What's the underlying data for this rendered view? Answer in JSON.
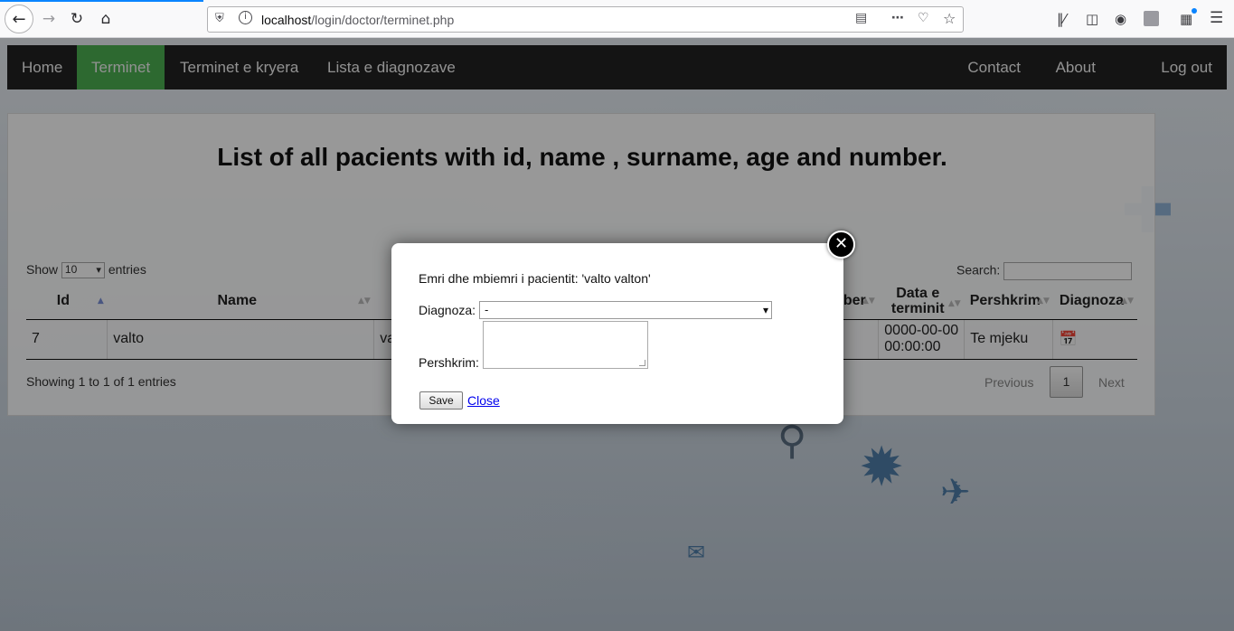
{
  "browser": {
    "url_host": "localhost",
    "url_path": "/login/doctor/terminet.php",
    "icons": [
      "back-icon",
      "forward-icon",
      "reload-icon",
      "home-icon",
      "shield-icon",
      "info-icon",
      "reader-icon",
      "more-icon",
      "pocket-icon",
      "star-icon",
      "library-icon",
      "sidebar-icon",
      "account-icon",
      "extensions-icon",
      "menu-icon"
    ]
  },
  "nav": {
    "home": "Home",
    "terminet": "Terminet",
    "kryera": "Terminet e kryera",
    "lista": "Lista e diagnozave",
    "contact": "Contact",
    "about": "About",
    "logout": "Log out",
    "active_color": "#4caf50"
  },
  "main": {
    "title": "List of all pacients with id, name , surname, age and number.",
    "show_label": "Show",
    "show_value": "10",
    "entries_label": "entries",
    "search_label": "Search:",
    "columns": [
      "Id",
      "Name",
      "",
      "ber",
      "Data e terminit",
      "Pershkrim",
      "Diagnoza"
    ],
    "rows": [
      {
        "id": "7",
        "name": "valto",
        "surname": "va",
        "number": "",
        "date": "0000-00-00 00:00:00",
        "pershkrim": "Te mjeku"
      }
    ],
    "info": "Showing 1 to 1 of 1 entries",
    "prev": "Previous",
    "page": "1",
    "next": "Next"
  },
  "modal": {
    "patient_text": "Emri dhe mbiemri i pacientit: 'valto valton'",
    "diag_label": "Diagnoza:",
    "diag_value": "-",
    "pers_label": "Pershkrim:",
    "save": "Save",
    "close": "Close"
  }
}
